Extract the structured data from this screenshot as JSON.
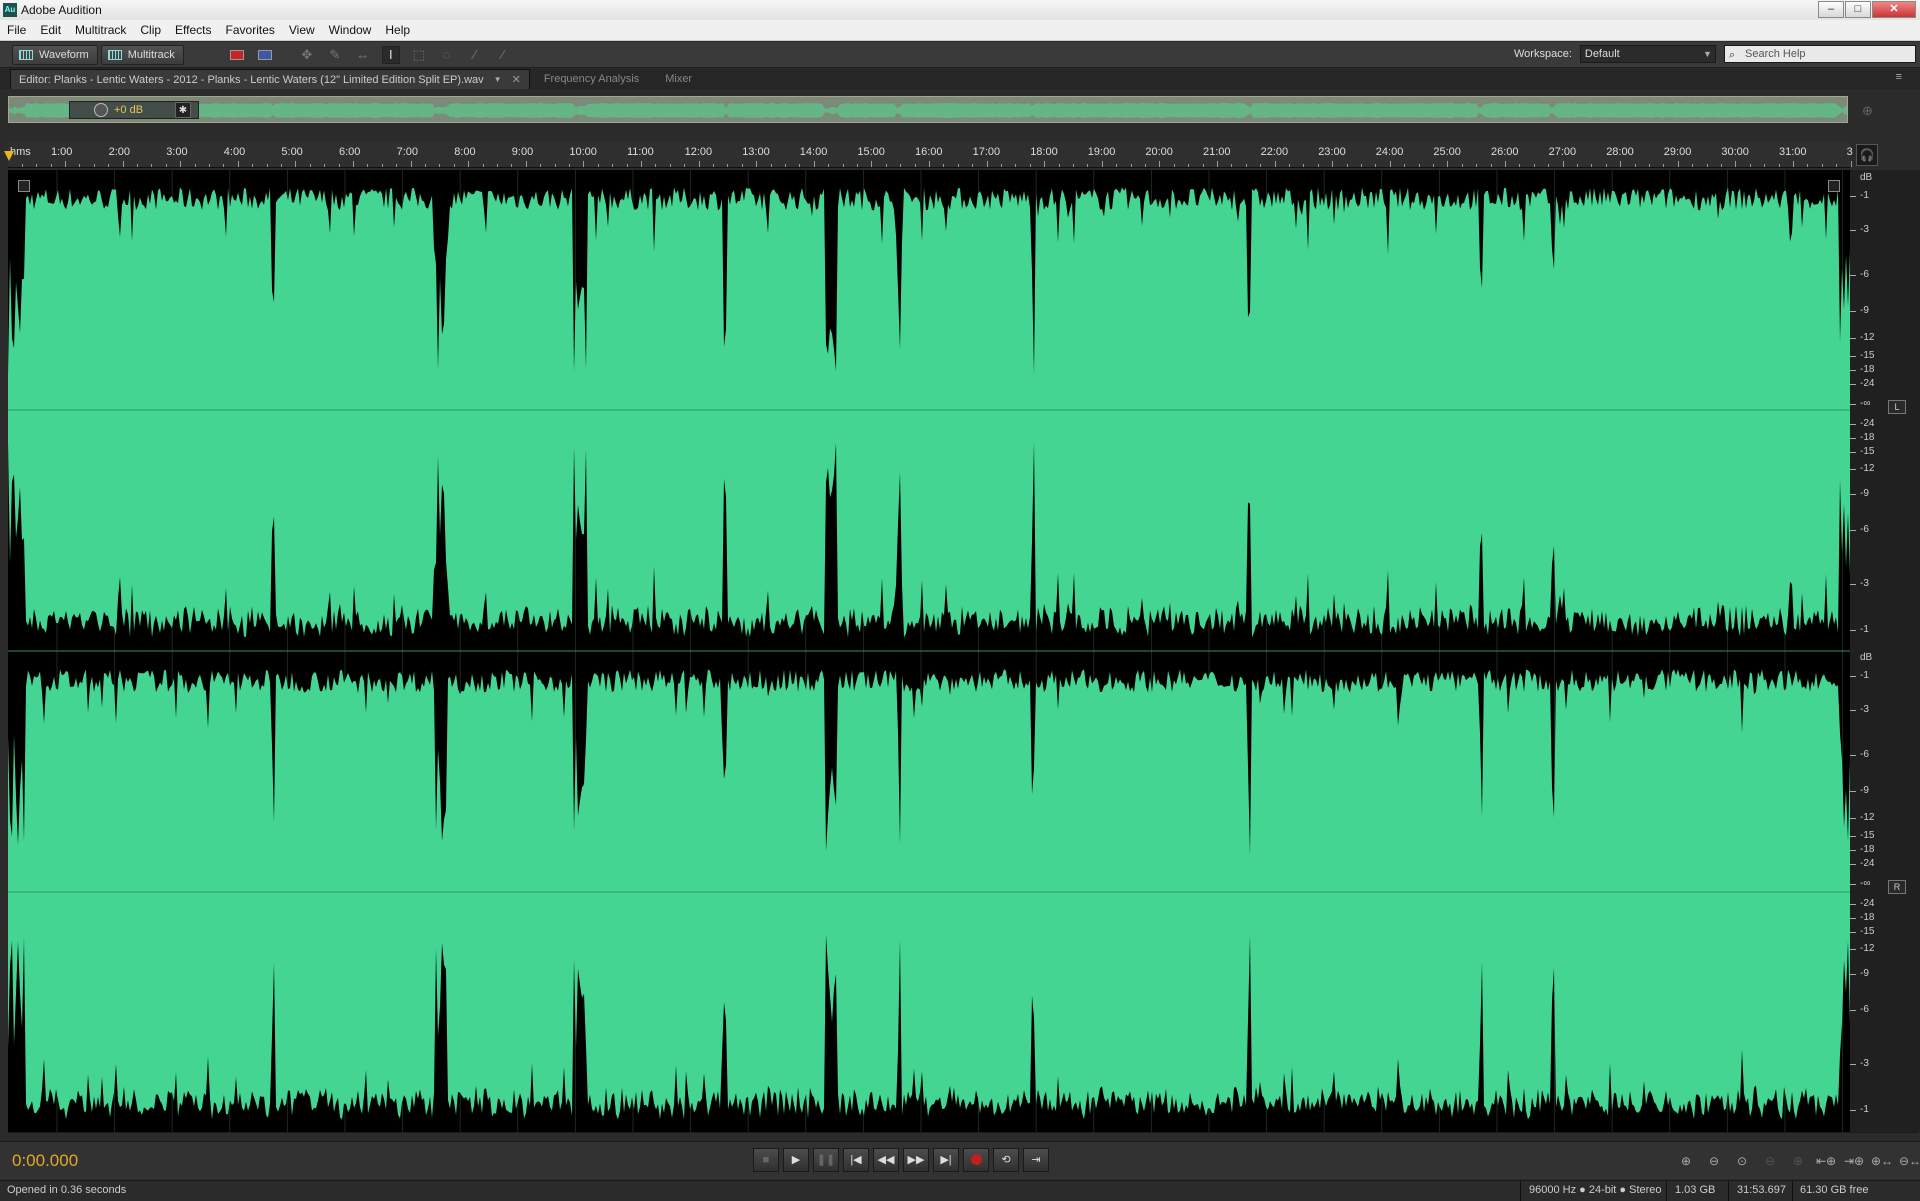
{
  "window": {
    "app_title": "Adobe Audition",
    "app_icon_text": "Au",
    "controls": {
      "minimize": "–",
      "maximize": "□",
      "close": "✕"
    }
  },
  "menu": [
    "File",
    "Edit",
    "Multitrack",
    "Clip",
    "Effects",
    "Favorites",
    "View",
    "Window",
    "Help"
  ],
  "toolbar": {
    "waveform_label": "Waveform",
    "multitrack_label": "Multitrack",
    "workspace_label": "Workspace:",
    "workspace_value": "Default",
    "search_placeholder": "Search Help"
  },
  "tabs": {
    "editor_label": "Editor: Planks - Lentic Waters - 2012 - Planks - Lentic Waters (12\" Limited Edition Split EP).wav",
    "frequency_label": "Frequency Analysis",
    "mixer_label": "Mixer"
  },
  "overview": {
    "hud_gain": "+0 dB",
    "pin_glyph": "✱"
  },
  "ruler": {
    "unit_label": "hms",
    "tick_labels": [
      "1:00",
      "2:00",
      "3:00",
      "4:00",
      "5:00",
      "6:00",
      "7:00",
      "8:00",
      "9:00",
      "10:00",
      "11:00",
      "12:00",
      "13:00",
      "14:00",
      "15:00",
      "16:00",
      "17:00",
      "18:00",
      "19:00",
      "20:00",
      "21:00",
      "22:00",
      "23:00",
      "24:00",
      "25:00",
      "26:00",
      "27:00",
      "28:00",
      "29:00",
      "30:00",
      "31:00",
      "3"
    ]
  },
  "db_scale": {
    "header": "dB",
    "labels": [
      "-1",
      "-3",
      "-6",
      "-9",
      "-12",
      "-15",
      "-18",
      "-24",
      "-∞",
      "-24",
      "-18",
      "-15",
      "-12",
      "-9",
      "-6",
      "-3",
      "-1"
    ],
    "left_channel": "L",
    "right_channel": "R"
  },
  "waveform": {
    "color": "#44d593",
    "duration_seconds": 1913.697,
    "clip_segments": [
      {
        "start": 15,
        "end": 275
      },
      {
        "start": 275,
        "end": 445
      },
      {
        "start": 455,
        "end": 590
      },
      {
        "start": 600,
        "end": 745
      },
      {
        "start": 745,
        "end": 850
      },
      {
        "start": 860,
        "end": 925
      },
      {
        "start": 925,
        "end": 1065
      },
      {
        "start": 1065,
        "end": 1290
      },
      {
        "start": 1290,
        "end": 1530
      },
      {
        "start": 1530,
        "end": 1605
      },
      {
        "start": 1605,
        "end": 1905
      }
    ]
  },
  "transport": {
    "current_time": "0:00.000",
    "buttons": [
      "■",
      "▶",
      "❚❚",
      "|◀",
      "◀◀",
      "▶▶",
      "▶|",
      "●",
      "⟲",
      "⇥"
    ]
  },
  "zoom": [
    "⊕",
    "⊖",
    "⊙",
    "⊖",
    "⊕",
    "⇤⊕",
    "⇥⊕",
    "⊕↔",
    "⊖↔"
  ],
  "status": {
    "message": "Opened in 0.36 seconds",
    "format": "96000 Hz ● 24-bit ● Stereo",
    "file_size": "1.03 GB",
    "duration": "31:53.697",
    "free_space": "61.30 GB free"
  }
}
